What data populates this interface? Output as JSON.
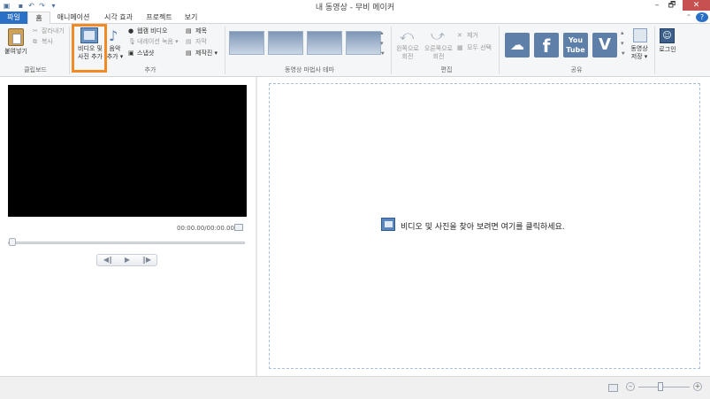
{
  "window": {
    "title": "내 동영상 - 무비 메이커",
    "minimize": "–",
    "maximize": "🗗",
    "close": "✕"
  },
  "quick_access": {
    "save_icon": "save-icon",
    "undo_icon": "undo-icon",
    "redo_icon": "redo-icon",
    "dropdown_icon": "dropdown-icon"
  },
  "tabs": [
    {
      "label": "파일",
      "active": false,
      "file": true
    },
    {
      "label": "홈",
      "active": true
    },
    {
      "label": "애니메이션"
    },
    {
      "label": "시각 효과"
    },
    {
      "label": "프로젝트"
    },
    {
      "label": "보기"
    }
  ],
  "ribbon": {
    "clipboard": {
      "group_label": "클립보드",
      "paste": "붙여넣기",
      "cut": "잘라내기",
      "copy": "복사"
    },
    "add": {
      "group_label": "추가",
      "add_videos_photos_line1": "비디오 및",
      "add_videos_photos_line2": "사진 추가",
      "add_music_line1": "음악",
      "add_music_line2": "추가 ▾",
      "webcam_video": "웹캠 비디오",
      "record_narration": "내레이션 녹음 ▾",
      "snapshot": "스냅샷",
      "title": "제목",
      "caption": "자막",
      "credits": "제작진 ▾"
    },
    "themes": {
      "group_label": "동영상 마법사 테마"
    },
    "editing": {
      "group_label": "편집",
      "rotate_left_line1": "왼쪽으로",
      "rotate_left_line2": "회전",
      "rotate_right_line1": "오른쪽으로",
      "rotate_right_line2": "회전",
      "remove": "제거",
      "select_all": "모두 선택"
    },
    "share": {
      "group_label": "공유",
      "onedrive_icon": "onedrive-icon",
      "facebook": "f",
      "youtube_line1": "You",
      "youtube_line2": "Tube",
      "vimeo": "V",
      "save_movie_line1": "동영상",
      "save_movie_line2": "저장 ▾"
    },
    "signin": {
      "label": "로그인"
    }
  },
  "preview": {
    "time": "00:00.00/00:00.00",
    "prev_frame": "◀‖",
    "play": "▶",
    "next_frame": "‖▶",
    "position_fraction": 0
  },
  "storyboard": {
    "hint": "비디오 및 사진을 찾아 보려면 여기를 클릭하세요."
  },
  "status": {
    "zoom_out": "–",
    "zoom_in": "+"
  },
  "colors": {
    "file_tab": "#2b70c7",
    "highlight": "#f08a24",
    "preview_bg": "#000000"
  }
}
